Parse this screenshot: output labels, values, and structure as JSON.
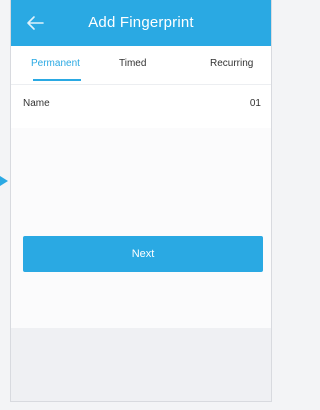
{
  "header": {
    "title": "Add Fingerprint",
    "back_icon": "arrow-left-icon"
  },
  "tabs": [
    {
      "label": "Permanent",
      "active": true
    },
    {
      "label": "Timed",
      "active": false
    },
    {
      "label": "Recurring",
      "active": false
    }
  ],
  "form": {
    "name_label": "Name",
    "name_value": "01"
  },
  "actions": {
    "next_label": "Next"
  },
  "colors": {
    "accent": "#2aa9e3",
    "background": "#eff0f3",
    "text": "#333333"
  }
}
